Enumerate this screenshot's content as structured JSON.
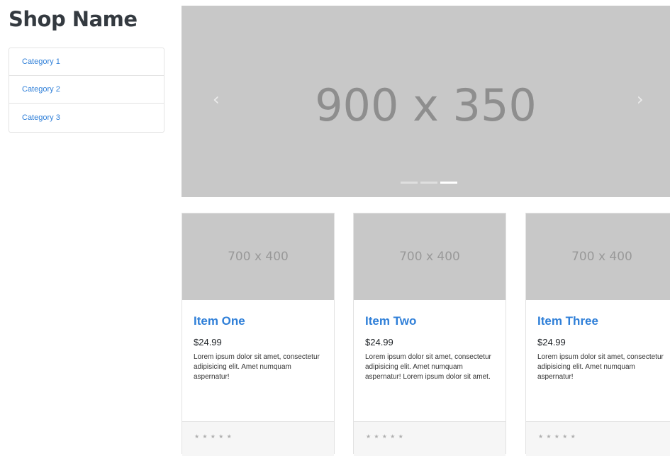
{
  "sidebar": {
    "shop_name": "Shop Name",
    "categories": [
      "Category 1",
      "Category 2",
      "Category 3"
    ]
  },
  "carousel": {
    "slide_label": "900 x 350",
    "prev_icon": "chevron-left-icon",
    "next_icon": "chevron-right-icon",
    "slide_count": 3,
    "active_slide": 3
  },
  "products": [
    {
      "thumb_label": "700 x 400",
      "title": "Item One",
      "price": "$24.99",
      "description": "Lorem ipsum dolor sit amet, consectetur adipisicing elit. Amet numquam aspernatur!",
      "rating": "★ ★ ★ ★ ★"
    },
    {
      "thumb_label": "700 x 400",
      "title": "Item Two",
      "price": "$24.99",
      "description": "Lorem ipsum dolor sit amet, consectetur adipisicing elit. Amet numquam aspernatur! Lorem ipsum dolor sit amet.",
      "rating": "★ ★ ★ ★ ★"
    },
    {
      "thumb_label": "700 x 400",
      "title": "Item Three",
      "price": "$24.99",
      "description": "Lorem ipsum dolor sit amet, consectetur adipisicing elit. Amet numquam aspernatur!",
      "rating": "★ ★ ★ ★ ★"
    }
  ],
  "colors": {
    "link": "#2f7fd8",
    "placeholder_bg": "#c8c8c8",
    "footer_bg": "#f6f6f6"
  }
}
